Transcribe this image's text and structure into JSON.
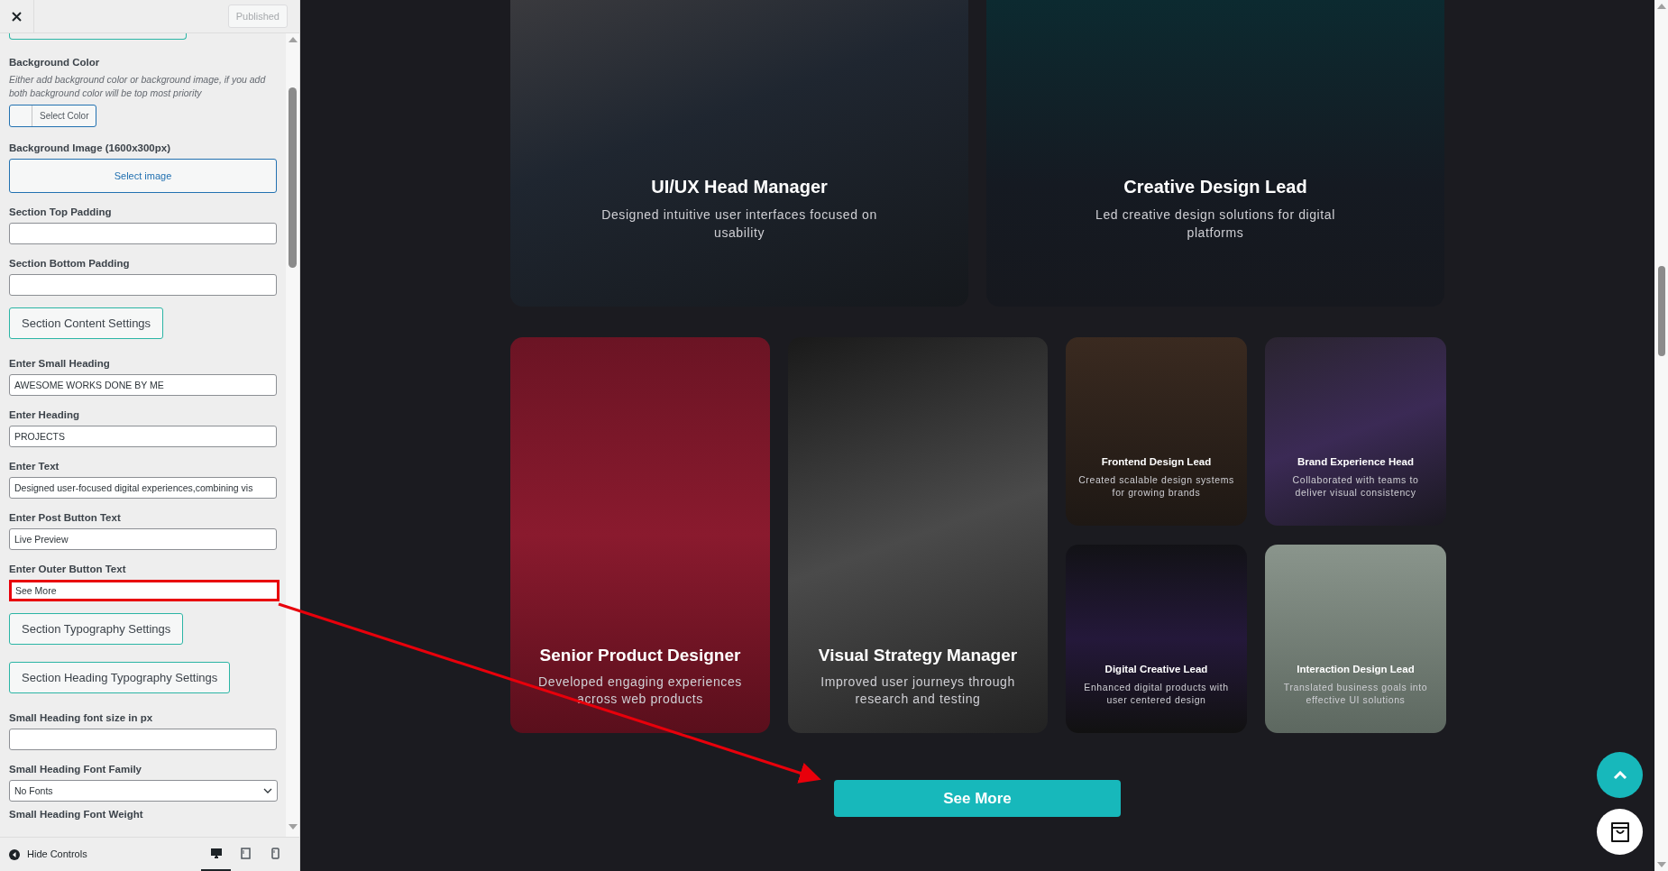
{
  "sidebar": {
    "publish_button": {
      "label": "Published",
      "disabled": true
    },
    "fields": [
      {
        "kind": "cut_button"
      },
      {
        "kind": "color",
        "label": "Background Color",
        "description": "Either add background color or background image, if you add both background color will be top most priority",
        "button": "Select Color"
      },
      {
        "kind": "image",
        "label": "Background Image (1600x300px)",
        "button": "Select image"
      },
      {
        "kind": "text",
        "label": "Section Top Padding",
        "highlighted": false
      },
      {
        "kind": "text",
        "label": "Section Bottom Padding",
        "highlighted": false
      },
      {
        "kind": "section_button",
        "label": "Section Content Settings"
      },
      {
        "kind": "text",
        "label": "Enter Small Heading",
        "value": "AWESOME WORKS DONE BY ME",
        "highlighted": false
      },
      {
        "kind": "text",
        "label": "Enter Heading",
        "value": "PROJECTS",
        "highlighted": false
      },
      {
        "kind": "text",
        "label": "Enter Text",
        "value": "Designed user-focused digital experiences,combining vis",
        "highlighted": false
      },
      {
        "kind": "text",
        "label": "Enter Post Button Text",
        "value": "Live Preview",
        "highlighted": false
      },
      {
        "kind": "text",
        "label": "Enter Outer Button Text",
        "value": "See More",
        "highlighted": true
      },
      {
        "kind": "section_button",
        "label": "Section Typography Settings"
      },
      {
        "kind": "section_button",
        "label": "Section Heading Typography Settings"
      },
      {
        "kind": "text",
        "label": "Small Heading font size in px",
        "highlighted": false
      },
      {
        "kind": "select",
        "label": "Small Heading Font Family",
        "value": "No Fonts"
      },
      {
        "kind": "label",
        "label": "Small Heading Font Weight"
      }
    ],
    "footer": {
      "hide_controls": "Hide Controls",
      "devices": [
        {
          "kind": "desktop",
          "selected": true
        },
        {
          "kind": "tablet",
          "selected": false
        },
        {
          "kind": "mobile",
          "selected": false
        }
      ]
    }
  },
  "preview": {
    "featured": [
      {
        "title": "UI/UX Head Manager",
        "text": "Designed intuitive user interfaces focused on usability"
      },
      {
        "title": "Creative Design Lead",
        "text": "Led creative design solutions for digital platforms"
      }
    ],
    "projects": [
      {
        "kind": "tall",
        "title": "Senior Product Designer",
        "text": "Developed engaging experiences across web products"
      },
      {
        "kind": "tall",
        "title": "Visual Strategy Manager",
        "text": "Improved user journeys through research and testing"
      },
      {
        "kind": "small",
        "title": "Frontend Design Lead",
        "text": "Created scalable design systems for growing brands"
      },
      {
        "kind": "small",
        "title": "Brand Experience Head",
        "text": "Collaborated with teams to deliver visual consistency"
      },
      {
        "kind": "small",
        "title": "Digital Creative Lead",
        "text": "Enhanced digital products with user centered design"
      },
      {
        "kind": "small",
        "title": "Interaction Design Lead",
        "text": "Translated business goals into effective UI solutions"
      }
    ],
    "outer_button": "See More"
  }
}
